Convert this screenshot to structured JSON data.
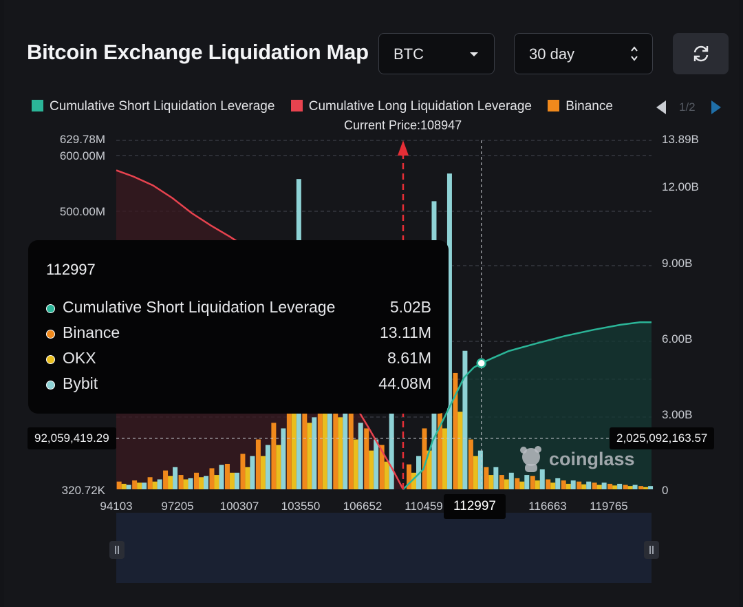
{
  "header": {
    "title": "Bitcoin Exchange Liquidation Map",
    "symbol_select": "BTC",
    "period_select": "30 day"
  },
  "icons": {
    "dropdown": "caret-down-icon",
    "stepper": "up-down-stepper-icon",
    "refresh": "refresh-icon",
    "prev": "triangle-left-icon",
    "next": "triangle-right-icon",
    "watermark": "coinglass-mascot-icon"
  },
  "colors": {
    "short": "#2bb598",
    "long": "#e8434f",
    "binance": "#f0891c",
    "okx": "#e9be1e",
    "bybit": "#8fd3d6",
    "price_line": "#e52e36"
  },
  "legend": {
    "items": [
      {
        "label": "Cumulative Short Liquidation Leverage",
        "color": "#2bb598"
      },
      {
        "label": "Cumulative Long Liquidation Leverage",
        "color": "#e8434f"
      },
      {
        "label": "Binance",
        "color": "#f0891c"
      }
    ],
    "pager": "1/2"
  },
  "current_price_label": "Current Price:108947",
  "tooltip": {
    "title": "112997",
    "rows": [
      {
        "label": "Cumulative Short Liquidation Leverage",
        "value": "5.02B",
        "color": "#2bb598"
      },
      {
        "label": "Binance",
        "value": "13.11M",
        "color": "#f0891c"
      },
      {
        "label": "OKX",
        "value": "8.61M",
        "color": "#e9be1e"
      },
      {
        "label": "Bybit",
        "value": "44.08M",
        "color": "#8fd3d6"
      }
    ]
  },
  "crosshair": {
    "left_value": "92,059,419.29",
    "right_value": "2,025,092,163.57",
    "x_value": "112997"
  },
  "watermark": "coinglass",
  "chart_data": {
    "type": "bar",
    "title": "Bitcoin Exchange Liquidation Map",
    "x_ticks": [
      "94103",
      "97205",
      "100307",
      "103550",
      "106652",
      "110459",
      "112997",
      "116663",
      "119765"
    ],
    "x_range": [
      94103,
      121800
    ],
    "current_price": 108947,
    "y_left_ticks": [
      "629.78M",
      "600.00M",
      "500.00M",
      "320.72K"
    ],
    "y_left_range": [
      320720,
      629780000
    ],
    "y_right_ticks": [
      "13.89B",
      "12.00B",
      "9.00B",
      "6.00B",
      "3.00B",
      "0"
    ],
    "y_right_range": [
      0,
      13890000000
    ],
    "series": [
      {
        "name": "Cumulative Long Liquidation Leverage",
        "type": "area",
        "x": [
          94103,
          95000,
          96000,
          97000,
          98000,
          99000,
          100000,
          100800,
          102000,
          103550,
          105000,
          106000,
          106652,
          107200,
          107800,
          108400,
          108947
        ],
        "y": [
          12.7,
          12.45,
          12.1,
          11.6,
          11.0,
          10.5,
          10.05,
          9.65,
          8.8,
          7.7,
          6.0,
          4.8,
          3.1,
          2.4,
          1.6,
          0.8,
          0.0
        ],
        "unit": "B"
      },
      {
        "name": "Cumulative Short Liquidation Leverage",
        "type": "area",
        "x": [
          108947,
          110000,
          110459,
          111300,
          112100,
          112600,
          112997,
          113500,
          114400,
          115800,
          117300,
          118800,
          120200,
          121200,
          121800
        ],
        "y": [
          0.0,
          0.8,
          1.9,
          3.2,
          4.45,
          4.85,
          5.02,
          5.2,
          5.5,
          5.8,
          6.1,
          6.35,
          6.55,
          6.65,
          6.65
        ],
        "unit": "B"
      },
      {
        "name": "Binance",
        "type": "bar",
        "x": [
          94500,
          95300,
          96100,
          96900,
          97700,
          98500,
          99300,
          100100,
          100900,
          101700,
          102500,
          103300,
          104100,
          104900,
          105700,
          106500,
          107300,
          108100,
          109500,
          110300,
          111100,
          111900,
          112700,
          113500,
          114300,
          115100,
          115900,
          116700,
          117500,
          118300,
          119100,
          119900,
          120700,
          121500
        ],
        "y": [
          14,
          16,
          22,
          34,
          26,
          30,
          38,
          46,
          64,
          90,
          120,
          230,
          180,
          240,
          200,
          140,
          110,
          80,
          45,
          110,
          170,
          210,
          90,
          40,
          26,
          20,
          24,
          18,
          16,
          14,
          12,
          10,
          8,
          6
        ],
        "unit": "M"
      },
      {
        "name": "OKX",
        "type": "bar",
        "x": [
          94500,
          95300,
          96100,
          96900,
          97700,
          98500,
          99300,
          100100,
          100900,
          101700,
          102500,
          103300,
          104100,
          104900,
          105700,
          106500,
          107300,
          108100,
          109500,
          110300,
          111100,
          111900,
          112700,
          113500,
          114300,
          115100,
          115900,
          116700,
          117500,
          118300,
          119100,
          119900,
          120700,
          121500
        ],
        "y": [
          10,
          12,
          14,
          24,
          18,
          22,
          26,
          30,
          40,
          60,
          80,
          150,
          120,
          160,
          130,
          90,
          70,
          50,
          30,
          70,
          110,
          140,
          60,
          26,
          18,
          14,
          16,
          12,
          10,
          9,
          8,
          7,
          6,
          4
        ],
        "unit": "M"
      },
      {
        "name": "Bybit",
        "type": "bar",
        "x": [
          94500,
          95300,
          96100,
          96900,
          97700,
          98500,
          99300,
          100100,
          100900,
          101700,
          102500,
          103300,
          104100,
          104900,
          105700,
          106500,
          107300,
          108100,
          109500,
          110300,
          111100,
          111900,
          112700,
          113500,
          114300,
          115100,
          115900,
          116700,
          117500,
          118300,
          119100,
          119900,
          120700,
          121500
        ],
        "y": [
          8,
          12,
          18,
          40,
          20,
          24,
          44,
          30,
          60,
          80,
          110,
          560,
          130,
          180,
          150,
          120,
          90,
          420,
          60,
          520,
          570,
          250,
          70,
          40,
          30,
          26,
          36,
          20,
          16,
          14,
          12,
          10,
          8,
          6
        ],
        "unit": "M"
      }
    ],
    "grid": true,
    "legend_position": "top"
  }
}
